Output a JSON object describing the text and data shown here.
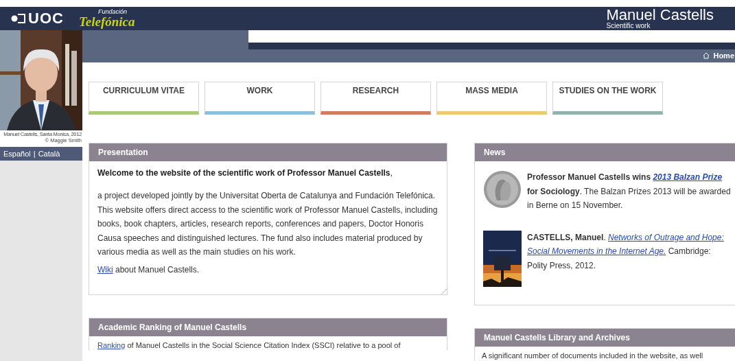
{
  "header": {
    "logos": [
      {
        "kind": "uoc",
        "text": "UOC"
      },
      {
        "kind": "telefonica",
        "small": "Fundación",
        "text": "Telefónica"
      }
    ],
    "site_title": "Manuel Castells",
    "site_subtitle": "Scientific work"
  },
  "photo": {
    "kind": "picture",
    "caption": "Manuel Castells, Santa Monica, 2012",
    "credit": "© Maggie Smith"
  },
  "languages": {
    "items": [
      "Español",
      "Català"
    ],
    "separator": "|"
  },
  "breadcrumb": {
    "label": "Home"
  },
  "nav": [
    {
      "label": "CURRICULUM VITAE",
      "color": "#a6c97a"
    },
    {
      "label": "WORK",
      "color": "#8cc0d8"
    },
    {
      "label": "RESEARCH",
      "color": "#d27a62"
    },
    {
      "label": "MASS MEDIA",
      "color": "#eacb6d"
    },
    {
      "label": "STUDIES ON THE WORK",
      "color": "#8fb3ad"
    }
  ],
  "presentation": {
    "title": "Presentation",
    "intro": "Welcome to the website of the scientific work of Professor Manuel Castells",
    "intro_end": ",",
    "paragraph": "a project developed jointly by the Universitat Oberta de Catalunya and Fundación Telefónica. This website offers direct access to the scientific work of Professor Manuel Castells, including books, book chapters, articles, research reports, conferences and papers, Doctor Honoris Causa speeches and distinguished lectures. The fund also includes material produced by various media as well as the main studies on his work.",
    "wiki": [
      {
        "kind": "link",
        "text": "Wiki"
      },
      {
        "kind": "text",
        "text": " about Manuel Castells."
      }
    ]
  },
  "news": {
    "title": "News",
    "items": [
      {
        "image": {
          "kind": "picture"
        },
        "segments": [
          {
            "kind": "bold",
            "text": "Professor Manuel Castells wins "
          },
          {
            "kind": "strongemlink",
            "text": "2013 Balzan Prize"
          },
          {
            "kind": "bold",
            "text": " for Sociology"
          },
          {
            "kind": "text",
            "text": ". The Balzan Prizes 2013 will be awarded in Berne on 15 November."
          }
        ]
      },
      {
        "image": {
          "kind": "picture"
        },
        "segments": [
          {
            "kind": "bold",
            "text": "CASTELLS, Manuel"
          },
          {
            "kind": "text",
            "text": ". "
          },
          {
            "kind": "emlink",
            "text": "Networks of Outrage and Hope:"
          },
          {
            "kind": "emlink",
            "text": "Social Movements in the Internet Age."
          },
          {
            "kind": "text",
            "text": " Cambridge: Polity Press, 2012."
          }
        ]
      }
    ]
  },
  "ranking": {
    "title": "Academic Ranking of Manuel Castells",
    "segments": [
      {
        "kind": "link",
        "text": "Ranking"
      },
      {
        "kind": "text",
        "text": " of Manuel Castells in the Social Science Citation Index (SSCI) relative to a pool of"
      }
    ]
  },
  "library": {
    "title": "Manuel Castells Library and Archives",
    "segments": [
      {
        "kind": "text",
        "text": "A significant number of documents included in the website, as well"
      }
    ]
  }
}
